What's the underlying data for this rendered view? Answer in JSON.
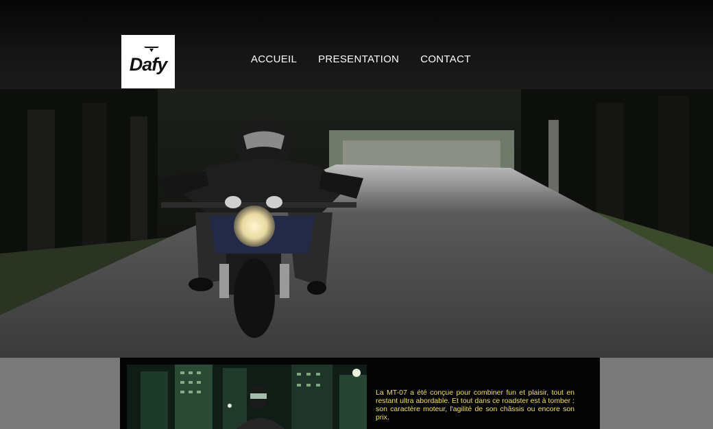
{
  "brand": {
    "logo_text": "Dafy"
  },
  "nav": {
    "items": [
      {
        "label": "ACCUEIL"
      },
      {
        "label": "PRESENTATION"
      },
      {
        "label": "CONTACT"
      }
    ]
  },
  "content": {
    "description": "La MT-07 a été conçue pour combiner fun et plaisir, tout en restant ultra abordable. Et tout dans ce roadster est à tomber : son caractère moteur, l'agilité de son châssis ou encore son prix."
  },
  "colors": {
    "header_bg": "#151515",
    "page_bg": "#7a7a7a",
    "text_accent": "#f0e05c",
    "nav_text": "#ffffff"
  }
}
